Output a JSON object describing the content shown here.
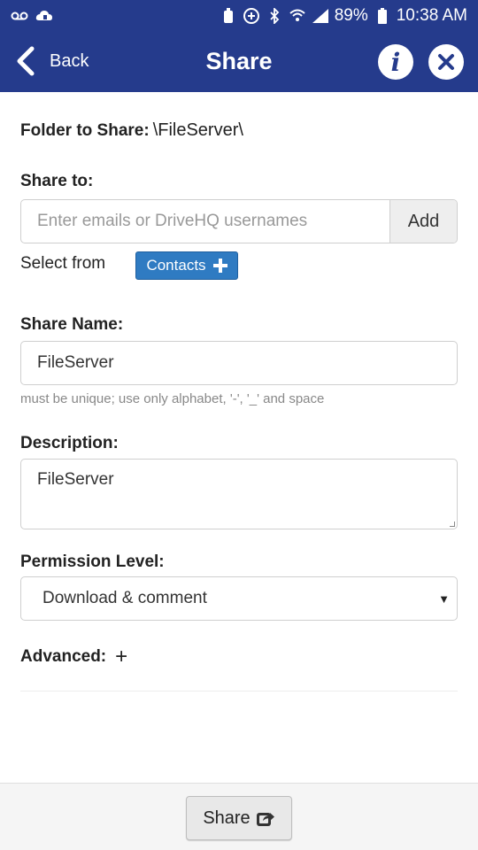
{
  "status_bar": {
    "battery": "89%",
    "time": "10:38 AM"
  },
  "header": {
    "back_label": "Back",
    "title": "Share"
  },
  "form": {
    "folder_label": "Folder to Share:",
    "folder_path": "\\FileServer\\",
    "share_to_label": "Share to:",
    "share_to_placeholder": "Enter emails or DriveHQ usernames",
    "add_label": "Add",
    "select_from_label": "Select from",
    "contacts_label": "Contacts",
    "share_name_label": "Share Name:",
    "share_name_value": "FileServer",
    "share_name_hint": "must be unique; use only alphabet, '-', '_' and space",
    "description_label": "Description:",
    "description_value": "FileServer",
    "permission_label": "Permission Level:",
    "permission_value": "Download & comment",
    "advanced_label": "Advanced:",
    "advanced_toggle": "+"
  },
  "footer": {
    "share_button_label": "Share"
  },
  "colors": {
    "brand": "#253b8c",
    "contacts_button": "#2f7bc2"
  }
}
